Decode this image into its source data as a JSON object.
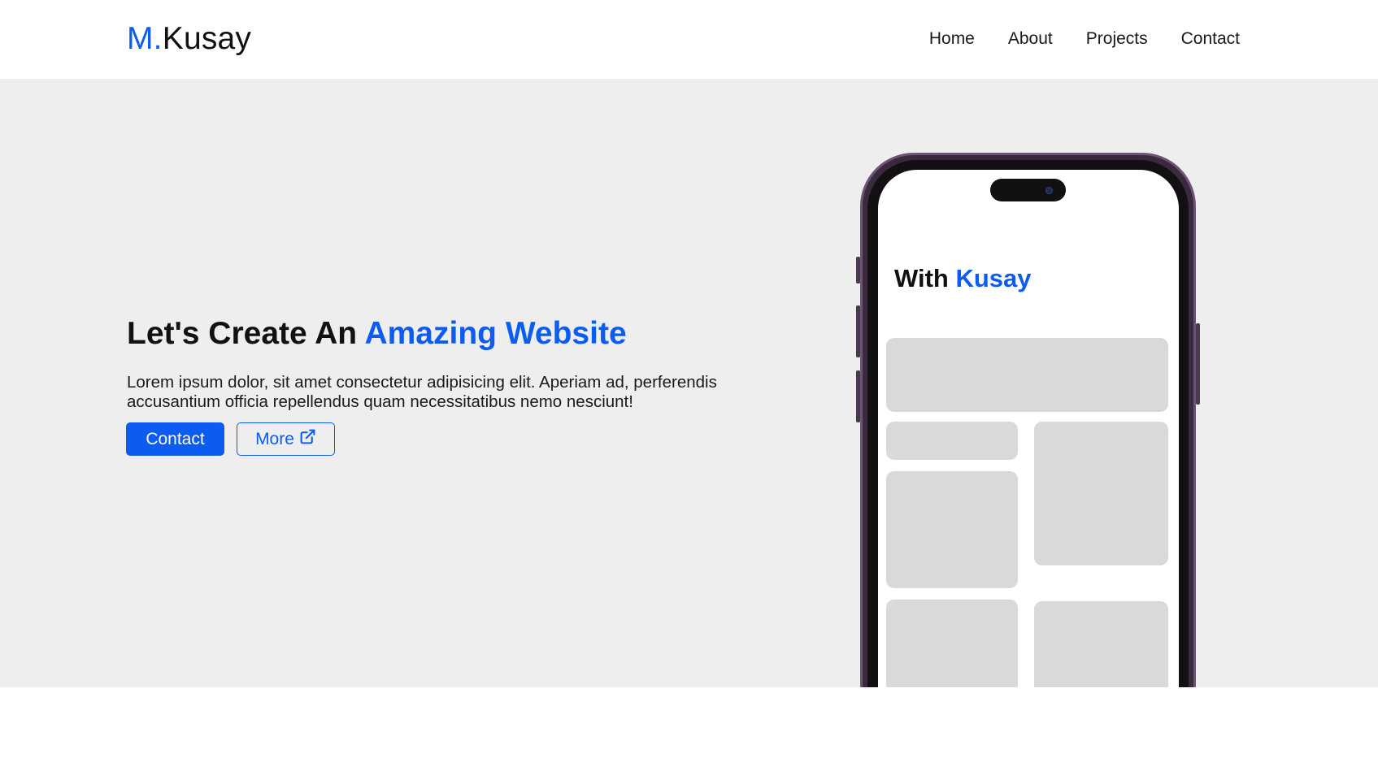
{
  "header": {
    "brand_prefix": "M.",
    "brand_name": "Kusay",
    "nav": [
      {
        "label": "Home"
      },
      {
        "label": "About"
      },
      {
        "label": "Projects"
      },
      {
        "label": "Contact"
      }
    ]
  },
  "hero": {
    "title_plain": "Let's Create An ",
    "title_accent": "Amazing Website",
    "description": "Lorem ipsum dolor, sit amet consectetur adipisicing elit. Aperiam ad, perferendis accusantium officia repellendus quam necessitatibus nemo nesciunt!",
    "buttons": {
      "primary_label": "Contact",
      "secondary_label": "More",
      "secondary_icon": "external-link-icon"
    }
  },
  "phone": {
    "title_plain": "With ",
    "title_accent": "Kusay"
  },
  "colors": {
    "accent": "#0d5cf2",
    "hero_bg": "#eeeeee",
    "placeholder": "#d9d9d9",
    "phone_frame": "#3b2a3d"
  }
}
